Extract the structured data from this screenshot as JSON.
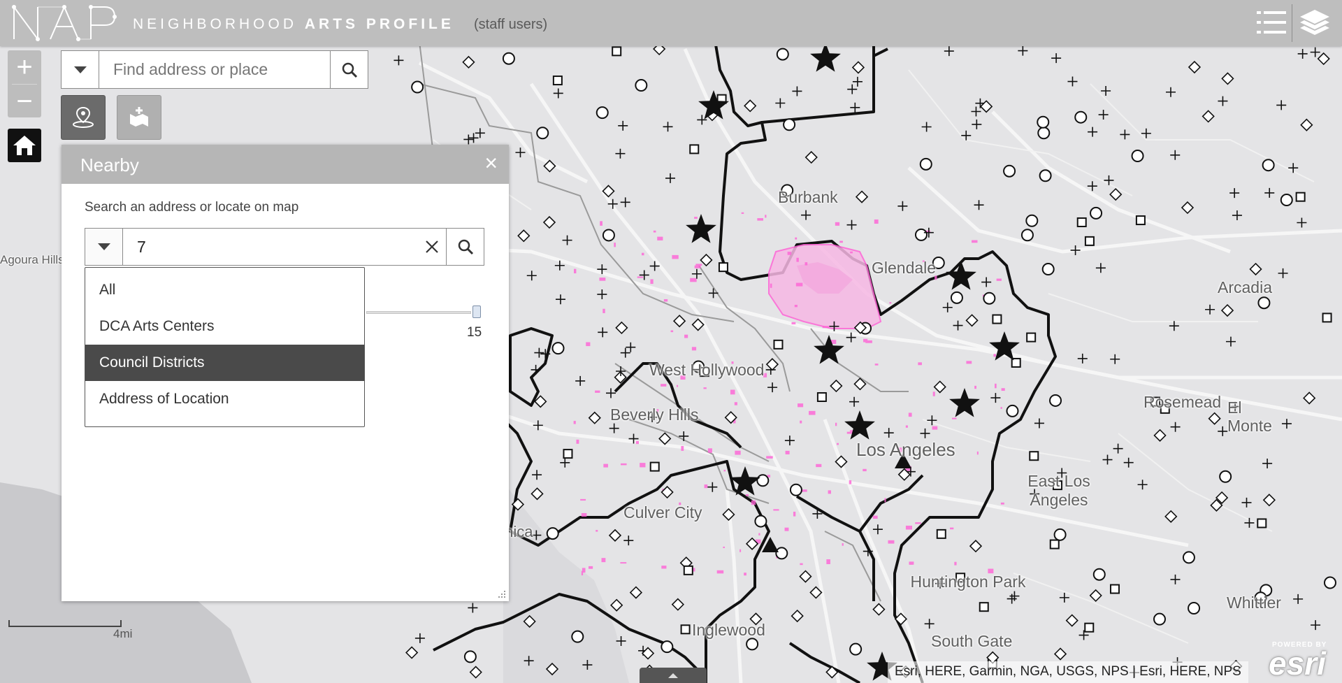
{
  "header": {
    "logo_text": "NAP",
    "title_prefix": "NEIGHBORHOOD ",
    "title_suffix": "ARTS PROFILE",
    "subtitle": "(staff users)",
    "list_icon": "list-icon",
    "layers_icon": "layers-icon"
  },
  "map_controls": {
    "zoom_in": "+",
    "zoom_out": "−",
    "home_icon": "home-icon"
  },
  "search": {
    "placeholder": "Find address or place",
    "value": ""
  },
  "tools": {
    "nearby_icon": "location-pin-icon",
    "draw_icon": "add-area-icon"
  },
  "nearby": {
    "title": "Nearby",
    "close": "×",
    "instruction": "Search an address or locate on map",
    "search_value": "7",
    "slider_max": "15",
    "menu": {
      "items": [
        "All",
        "DCA Arts Centers",
        "Council Districts",
        "Address of Location"
      ],
      "selected": "Council Districts"
    }
  },
  "map_labels": [
    "Agoura Hills",
    "Burbank",
    "Glendale",
    "Arcadia",
    "West Hollywood",
    "Beverly Hills",
    "Rosemead",
    "El Monte",
    "Los Angeles",
    "East Los Angeles",
    "Culver City",
    "Santa Monica",
    "Huntington Park",
    "Whittier",
    "Inglewood",
    "South Gate"
  ],
  "scale": {
    "label": "4mi"
  },
  "attribution": "Esri, HERE, Garmin, NGA, USGS, NPS | Esri, HERE, NPS",
  "esri": {
    "powered": "POWERED BY",
    "word": "esri"
  },
  "colors": {
    "header": "#bebebe",
    "accent_pink": "#ff63d6",
    "map_bg": "#e4e4e6",
    "selected_item": "#4a4a4a"
  }
}
